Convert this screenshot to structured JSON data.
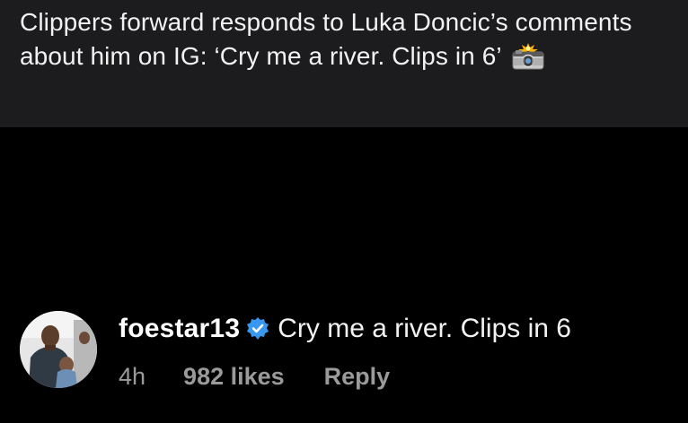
{
  "post": {
    "headline": "Clippers forward responds to Luka Doncic’s comments about him on IG: ‘Cry me a river. Clips in 6’",
    "headline_emoji": "camera-with-flash-emoji"
  },
  "comment": {
    "avatar_icon": "user-avatar-photo",
    "username": "foestar13",
    "verified_icon": "verified-badge-icon",
    "text": "Cry me a river. Clips in 6",
    "time": "4h",
    "likes": "982 likes",
    "reply_label": "Reply"
  },
  "colors": {
    "background": "#000000",
    "card": "#1c1c1e",
    "verified_blue": "#3897f0",
    "meta_gray": "#9a9a9a"
  }
}
